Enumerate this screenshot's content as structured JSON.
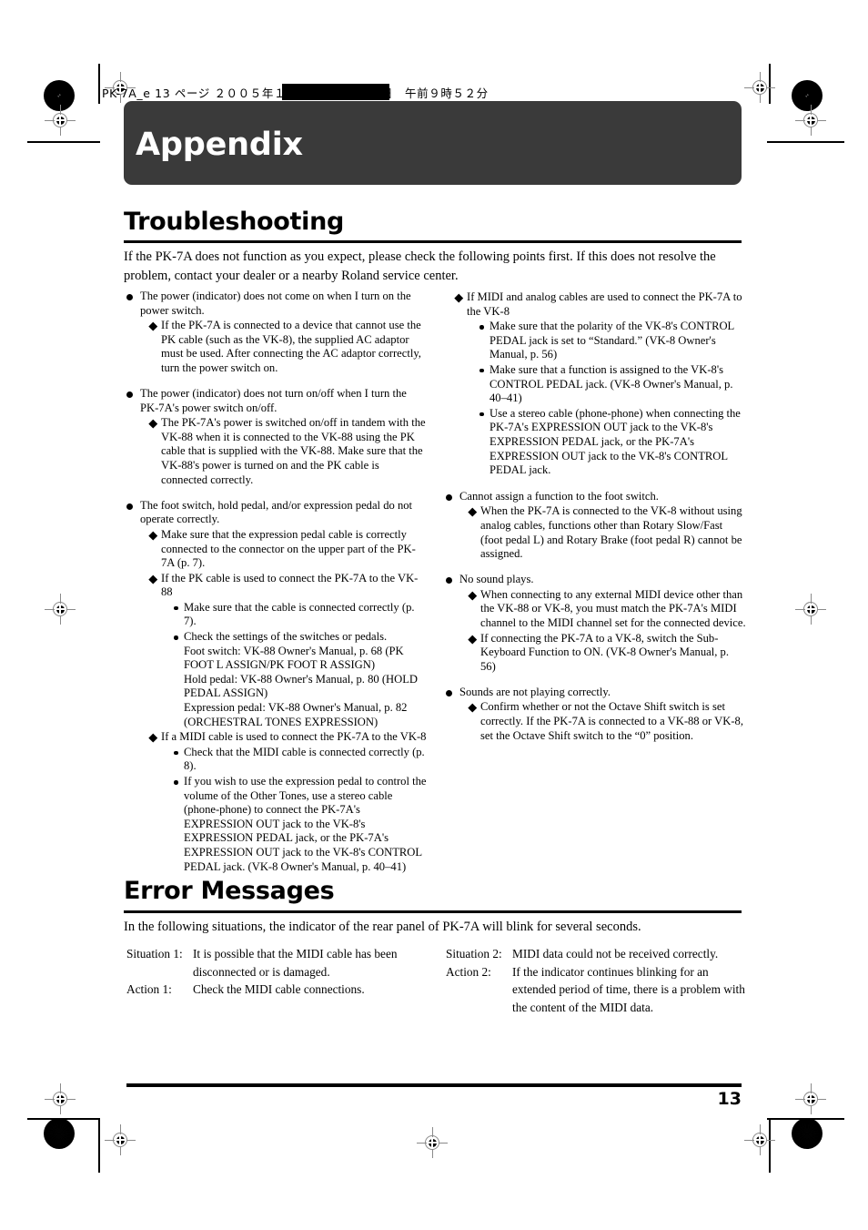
{
  "print_header": {
    "text": "PK-7A_e 13 ページ  ２００５年１１月１７日　木曜日　午前９時５２分"
  },
  "banner": {
    "title": "Appendix"
  },
  "troubleshooting": {
    "heading": "Troubleshooting",
    "lead": "If the PK-7A does not function as you expect, please check the following points first. If this does not resolve the problem, contact your dealer or a nearby Roland service center.",
    "left_column": [
      {
        "head": "The power (indicator) does not come on when I turn on the power switch.",
        "items": [
          {
            "text": "If the PK-7A is connected to a device that cannot use the PK cable (such as the VK-8), the supplied AC adaptor must be used. After connecting the AC adaptor correctly, turn the power switch on."
          }
        ]
      },
      {
        "head": "The power (indicator) does not turn on/off when I turn the PK-7A's power switch on/off.",
        "items": [
          {
            "text": "The PK-7A's power is switched on/off in tandem with the VK-88 when it is connected to the VK-88 using the PK cable that is supplied with the VK-88. Make sure that the VK-88's power is turned on and the PK cable is connected correctly."
          }
        ]
      },
      {
        "head": "The foot switch, hold pedal, and/or expression pedal do not operate correctly.",
        "items": [
          {
            "text": "Make sure that the expression pedal cable is correctly connected to the connector on the upper part of the PK-7A (p. 7)."
          },
          {
            "text": "If the PK cable is used to connect the PK-7A to the VK-88",
            "subitems": [
              {
                "text": "Make sure that the cable is connected correctly (p. 7)."
              },
              {
                "text": "Check the settings of the switches or pedals.",
                "continued": [
                  "Foot switch: VK-88 Owner's Manual, p. 68 (PK FOOT L ASSIGN/PK FOOT R ASSIGN)",
                  "Hold pedal: VK-88 Owner's Manual, p. 80 (HOLD PEDAL ASSIGN)",
                  "Expression pedal: VK-88 Owner's Manual, p. 82 (ORCHESTRAL TONES EXPRESSION)"
                ]
              }
            ]
          },
          {
            "text": "If a MIDI cable is used to connect the PK-7A to the VK-8",
            "subitems": [
              {
                "text": "Check that the MIDI cable is connected correctly (p. 8)."
              },
              {
                "text": "If you wish to use the expression pedal to control the volume of the Other Tones, use a stereo cable (phone-phone) to connect the PK-7A's EXPRESSION OUT jack to the VK-8's EXPRESSION PEDAL jack, or the PK-7A's EXPRESSION OUT jack to the VK-8's CONTROL PEDAL jack. (VK-8 Owner's Manual, p. 40–41)"
              }
            ]
          }
        ]
      }
    ],
    "right_column_continuation": {
      "text": "If MIDI and analog cables are used to connect the PK-7A to the VK-8",
      "subitems": [
        {
          "text": "Make sure that the polarity of the VK-8's CONTROL PEDAL jack is set to “Standard.” (VK-8 Owner's Manual, p. 56)"
        },
        {
          "text": "Make sure that a function is assigned to the VK-8's CONTROL PEDAL jack. (VK-8 Owner's Manual, p. 40–41)"
        },
        {
          "text": "Use a stereo cable (phone-phone) when connecting the PK-7A's EXPRESSION OUT jack to the VK-8's EXPRESSION PEDAL jack, or the PK-7A's EXPRESSION OUT jack to the VK-8's CONTROL PEDAL jack."
        }
      ]
    },
    "right_column": [
      {
        "head": "Cannot assign a function to the foot switch.",
        "items": [
          {
            "text": "When the PK-7A is connected to the VK-8 without using analog cables, functions other than Rotary Slow/Fast (foot pedal L) and Rotary Brake (foot pedal R) cannot be assigned."
          }
        ]
      },
      {
        "head": "No sound plays.",
        "items": [
          {
            "text": "When connecting to any external MIDI device other than the VK-88 or VK-8, you must match the PK-7A's MIDI channel to the MIDI channel set for the connected device."
          },
          {
            "text": "If connecting the PK-7A to a VK-8, switch the Sub-Keyboard Function to ON. (VK-8 Owner's Manual, p. 56)"
          }
        ]
      },
      {
        "head": "Sounds are not playing correctly.",
        "items": [
          {
            "text": "Confirm whether or not the Octave Shift switch is set correctly. If the PK-7A is connected to a VK-88 or VK-8, set the Octave Shift switch to the “0” position."
          }
        ]
      }
    ]
  },
  "error_messages": {
    "heading": "Error Messages",
    "lead": "In the following situations, the indicator of the rear panel of PK-7A will blink for several seconds.",
    "left": [
      {
        "label": "Situation 1:",
        "text": "It is possible that the MIDI cable has been disconnected or is damaged."
      },
      {
        "label": "Action 1:",
        "text": "Check the MIDI cable connections."
      }
    ],
    "right": [
      {
        "label": "Situation 2:",
        "text": "MIDI data could not be received correctly."
      },
      {
        "label": "Action 2:",
        "text": "If the indicator continues blinking for an extended period of time, there is a problem with the content of the MIDI data."
      }
    ]
  },
  "footer": {
    "page_number": "13"
  }
}
